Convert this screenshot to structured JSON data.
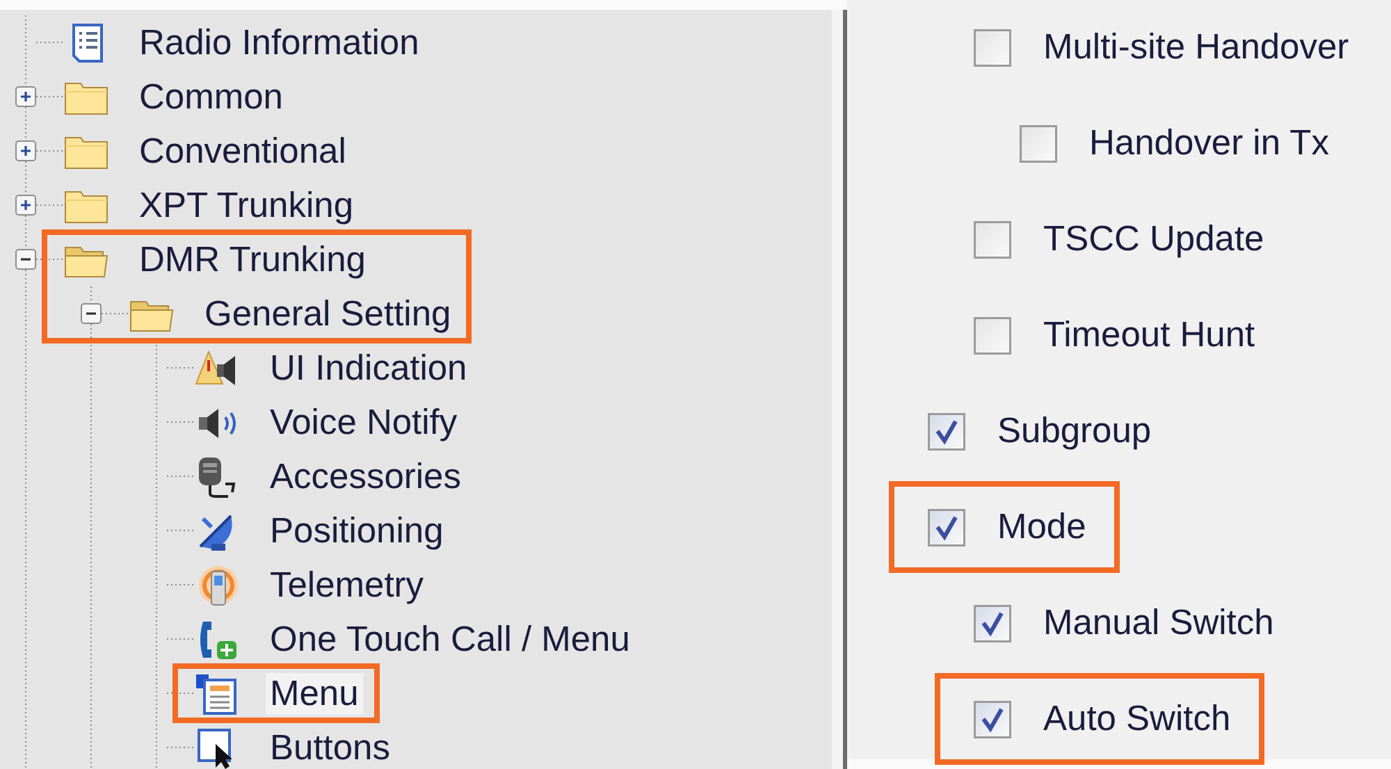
{
  "tree": [
    {
      "label": "Radio Information",
      "selected": false,
      "highlighted": false
    },
    {
      "label": "Common",
      "expanded": false,
      "selected": false,
      "highlighted": false
    },
    {
      "label": "Conventional",
      "expanded": false,
      "selected": false,
      "highlighted": false
    },
    {
      "label": "XPT Trunking",
      "expanded": false,
      "selected": false,
      "highlighted": false
    },
    {
      "label": "DMR Trunking",
      "expanded": true,
      "selected": false,
      "highlighted": true,
      "children": [
        {
          "label": "General Setting",
          "expanded": true,
          "selected": false,
          "highlighted": true,
          "children": [
            {
              "label": "UI Indication",
              "selected": false,
              "highlighted": false
            },
            {
              "label": "Voice Notify",
              "selected": false,
              "highlighted": false
            },
            {
              "label": "Accessories",
              "selected": false,
              "highlighted": false
            },
            {
              "label": "Positioning",
              "selected": false,
              "highlighted": false
            },
            {
              "label": "Telemetry",
              "selected": false,
              "highlighted": false
            },
            {
              "label": "One Touch Call / Menu",
              "selected": false,
              "highlighted": false
            },
            {
              "label": "Menu",
              "selected": true,
              "highlighted": true
            },
            {
              "label": "Buttons",
              "selected": false,
              "highlighted": false
            }
          ]
        }
      ]
    }
  ],
  "options": [
    {
      "children": [
        {
          "label": "Multi-site Handover",
          "checked": false,
          "highlighted": false,
          "children": [
            {
              "label": "Handover in Tx",
              "checked": false,
              "highlighted": false
            }
          ]
        },
        {
          "label": "TSCC Update",
          "checked": false,
          "highlighted": false
        },
        {
          "label": "Timeout Hunt",
          "checked": false,
          "highlighted": false
        }
      ]
    },
    {
      "label": "Subgroup",
      "checked": true,
      "highlighted": false
    },
    {
      "label": "Mode",
      "checked": true,
      "highlighted": true,
      "children": [
        {
          "label": "Manual Switch",
          "checked": true,
          "highlighted": false
        },
        {
          "label": "Auto Switch",
          "checked": true,
          "highlighted": true
        }
      ]
    }
  ]
}
